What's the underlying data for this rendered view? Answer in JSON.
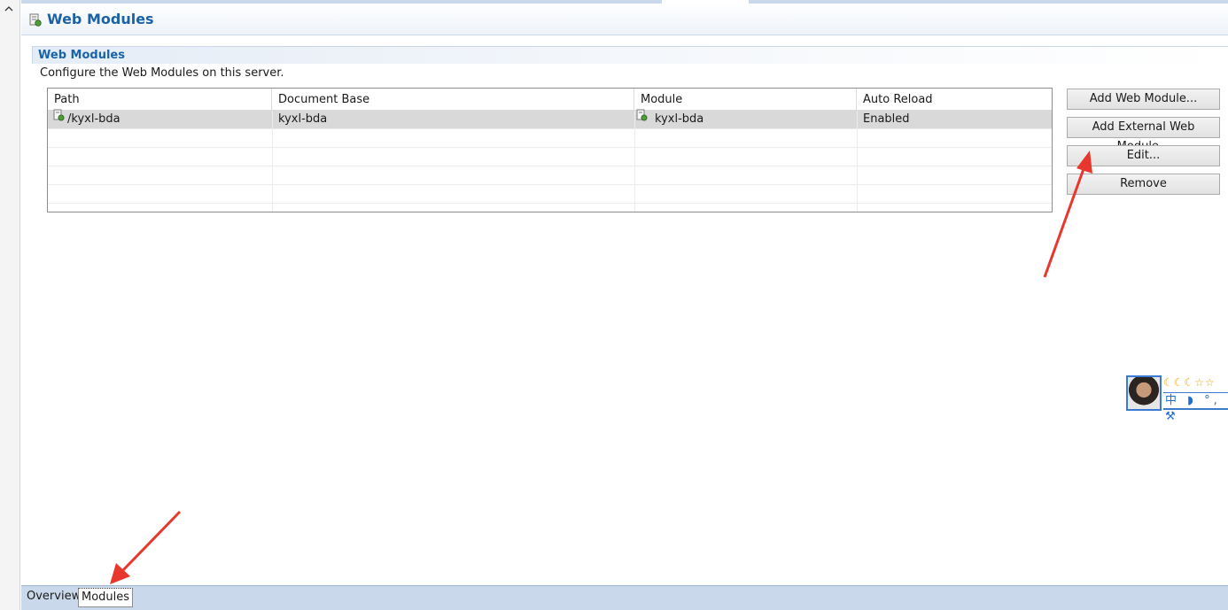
{
  "editor": {
    "title": "Web Modules",
    "section_title": "Web Modules",
    "description": "Configure the Web Modules on this server."
  },
  "table": {
    "columns": [
      "Path",
      "Document Base",
      "Module",
      "Auto Reload"
    ],
    "rows": [
      {
        "path": "/kyxl-bda",
        "document_base": "kyxl-bda",
        "module": "kyxl-bda",
        "auto_reload": "Enabled"
      }
    ]
  },
  "buttons": {
    "add_web_module": "Add Web Module...",
    "add_external_web_module": "Add External Web Module...",
    "edit": "Edit...",
    "remove": "Remove"
  },
  "tabs": [
    {
      "label": "Overview"
    },
    {
      "label": "Modules"
    }
  ],
  "ime": {
    "top_icons": "☾☾☾☆☆",
    "bottom_icons": "中 ◗ °, ⚒"
  },
  "colors": {
    "title_blue": "#1a63a8",
    "annotation_red": "#e8372c",
    "tab_bar": "#c9d8ea"
  },
  "icons": {
    "collapse": "chevron-up-icon",
    "server": "server-module-icon",
    "module": "web-module-icon"
  }
}
